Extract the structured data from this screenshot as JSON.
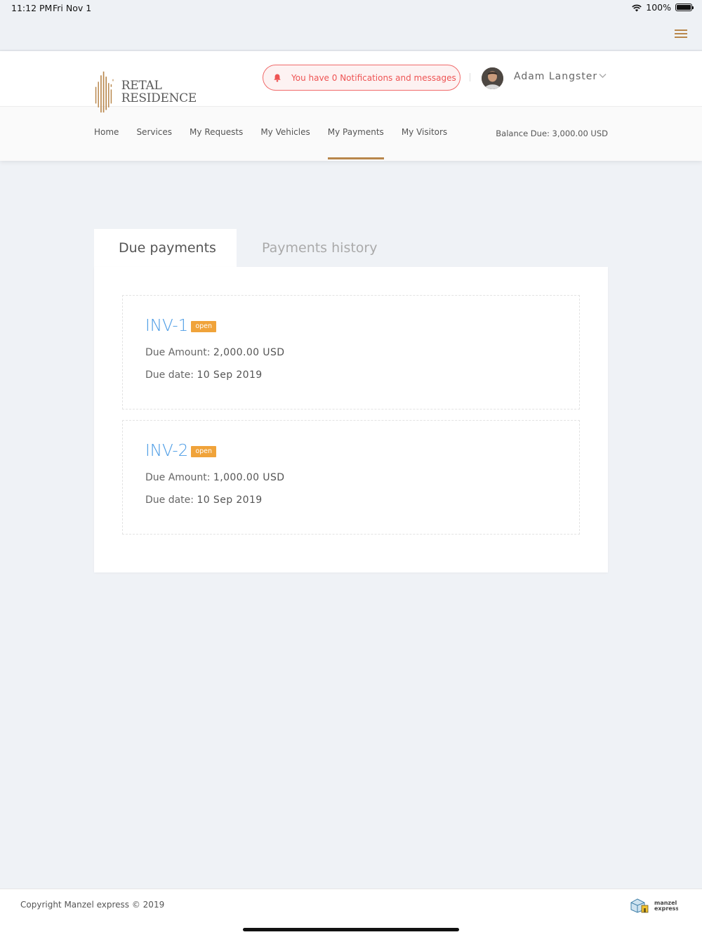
{
  "status_bar": {
    "time": "11:12 PM",
    "date": "Fri Nov 1",
    "battery": "100%",
    "icons": [
      "wifi-icon",
      "battery-icon"
    ]
  },
  "app_bar": {
    "menu_icon": "hamburger-menu-icon"
  },
  "header": {
    "logo": {
      "line1": "RETAL",
      "line2": "RESIDENCE"
    },
    "notification": {
      "icon": "bell-icon",
      "text": "You have 0 Notifications and messages"
    },
    "user": {
      "name": "Adam Langster",
      "avatar": "avatar-photo",
      "chevron": "chevron-down-icon"
    },
    "nav": [
      {
        "label": "Home"
      },
      {
        "label": "Services"
      },
      {
        "label": "My Requests"
      },
      {
        "label": "My Vehicles"
      },
      {
        "label": "My Payments",
        "active": true
      },
      {
        "label": "My Visitors"
      }
    ],
    "balance": "Balance Due: 3,000.00 USD"
  },
  "tabs": {
    "due": "Due payments",
    "history": "Payments history",
    "active": "due"
  },
  "invoices": [
    {
      "id": "INV-1",
      "status": "open",
      "amount_label": "Due Amount:",
      "amount": "2,000.00 USD",
      "date_label": "Due date:",
      "date": "10 Sep 2019"
    },
    {
      "id": "INV-2",
      "status": "open",
      "amount_label": "Due Amount:",
      "amount": "1,000.00 USD",
      "date_label": "Due date:",
      "date": "10 Sep 2019"
    }
  ],
  "footer": {
    "copyright": "Copyright Manzel express © 2019",
    "logo_line1": "manzel",
    "logo_line2": "express"
  },
  "colors": {
    "accent": "#b8864b",
    "link": "#4a9be5",
    "badge": "#f0a33a",
    "alert": "#ee5454",
    "background": "#eff2f6"
  }
}
